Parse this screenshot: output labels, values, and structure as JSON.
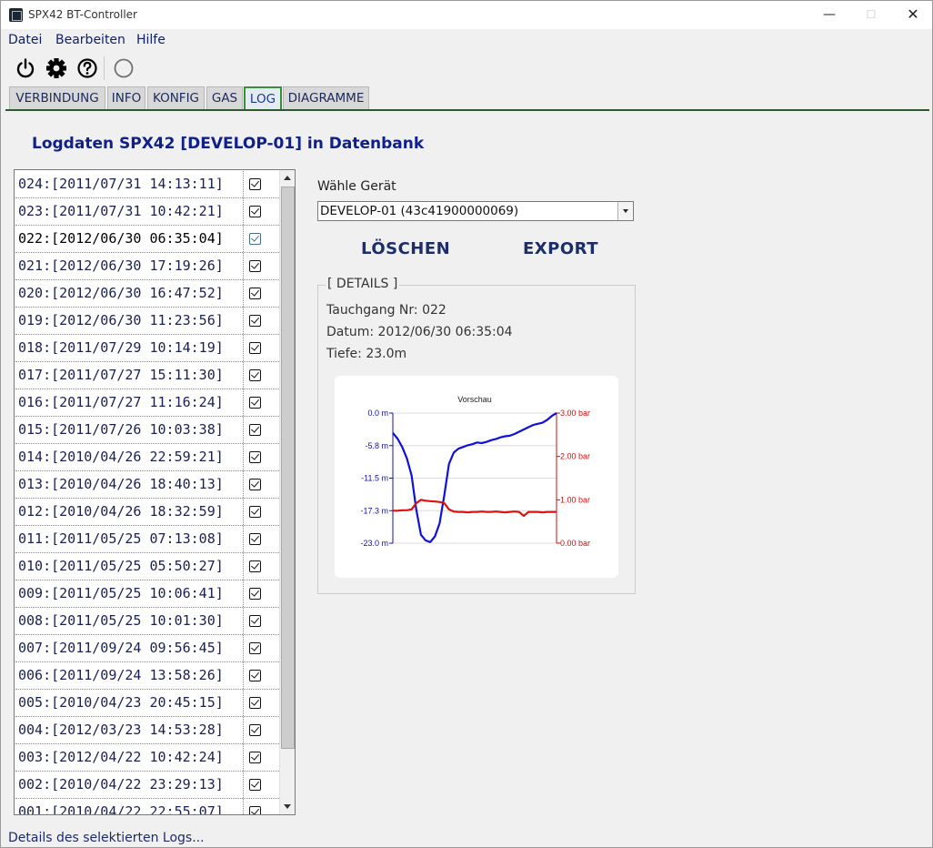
{
  "window": {
    "title": "SPX42 BT-Controller",
    "min": "—",
    "max": "☐",
    "close": "✕"
  },
  "menu": [
    "Datei",
    "Bearbeiten",
    "Hilfe"
  ],
  "toolbar": {
    "icons": [
      "power-icon",
      "gear-icon",
      "help-icon",
      "spinner-icon"
    ]
  },
  "tabs": [
    "VERBINDUNG",
    "INFO",
    "KONFIG",
    "GAS",
    "LOG",
    "DIAGRAMME"
  ],
  "active_tab": "LOG",
  "heading": "Logdaten SPX42 [DEVELOP-01] in Datenbank",
  "logs": [
    "024:[2011/07/31 14:13:11]",
    "023:[2011/07/31 10:42:21]",
    "022:[2012/06/30 06:35:04]",
    "021:[2012/06/30 17:19:26]",
    "020:[2012/06/30 16:47:52]",
    "019:[2012/06/30 11:23:56]",
    "018:[2011/07/29 10:14:19]",
    "017:[2011/07/27 15:11:30]",
    "016:[2011/07/27 11:16:24]",
    "015:[2011/07/26 10:03:38]",
    "014:[2010/04/26 22:59:21]",
    "013:[2010/04/26 18:40:13]",
    "012:[2010/04/26 18:32:59]",
    "011:[2011/05/25 07:13:08]",
    "010:[2011/05/25 05:50:27]",
    "009:[2011/05/25 10:06:41]",
    "008:[2011/05/25 10:01:30]",
    "007:[2011/09/24 09:56:45]",
    "006:[2011/09/24 13:58:26]",
    "005:[2010/04/23 20:45:15]",
    "004:[2012/03/23 14:53:28]",
    "003:[2012/04/22 10:42:24]",
    "002:[2010/04/22 23:29:13]",
    "001:[2010/04/22 22:55:07]"
  ],
  "selected_log_index": 2,
  "device": {
    "label": "Wähle Gerät",
    "selected": "DEVELOP-01 (43c41900000069)"
  },
  "buttons": {
    "delete": "LÖSCHEN",
    "export": "EXPORT"
  },
  "details": {
    "legend": "[ DETAILS ]",
    "dive_no": "Tauchgang Nr: 022",
    "date": "Datum: 2012/06/30 06:35:04",
    "depth": "Tiefe: 23.0m"
  },
  "chart_data": {
    "type": "line",
    "title": "Vorschau",
    "x": [
      0,
      1,
      2,
      3,
      4,
      5,
      6,
      7,
      8,
      9,
      10,
      11,
      12,
      13,
      14,
      15,
      16,
      17,
      18,
      19,
      20,
      21,
      22,
      23,
      24,
      25,
      26,
      27,
      28,
      29,
      30,
      31,
      32,
      33,
      34,
      35
    ],
    "series": [
      {
        "name": "",
        "axis": "left",
        "color": "#1010dd",
        "values": [
          -3.5,
          -4.5,
          -6.0,
          -8.0,
          -11.0,
          -17.0,
          -21.5,
          -22.5,
          -22.8,
          -21.8,
          -19.5,
          -14.5,
          -9.0,
          -7.0,
          -6.3,
          -6.0,
          -5.7,
          -5.5,
          -5.2,
          -5.3,
          -5.1,
          -4.8,
          -4.6,
          -4.3,
          -4.1,
          -4.0,
          -3.7,
          -3.3,
          -2.9,
          -2.5,
          -2.1,
          -1.9,
          -1.7,
          -1.2,
          -0.5,
          0.0
        ]
      },
      {
        "name": "",
        "axis": "right",
        "color": "#dd1010",
        "values": [
          0.75,
          0.75,
          0.76,
          0.76,
          0.78,
          0.92,
          1.0,
          0.98,
          0.97,
          0.96,
          0.95,
          0.92,
          0.78,
          0.73,
          0.72,
          0.72,
          0.71,
          0.72,
          0.72,
          0.73,
          0.72,
          0.72,
          0.73,
          0.72,
          0.71,
          0.72,
          0.73,
          0.72,
          0.63,
          0.72,
          0.72,
          0.72,
          0.71,
          0.72,
          0.72,
          0.72
        ]
      }
    ],
    "y_left": {
      "ticks": [
        "0.0 m",
        "-5.8 m",
        "-11.5 m",
        "-17.3 m",
        "-23.0 m"
      ],
      "range": [
        -23.0,
        0.0
      ],
      "color": "#1010aa"
    },
    "y_right": {
      "ticks": [
        "3.00 bar",
        "2.00 bar",
        "1.00 bar",
        "0.00 bar"
      ],
      "range": [
        0.0,
        3.0
      ],
      "color": "#cc1010"
    },
    "grid": true
  },
  "status": "Details des selektierten Logs..."
}
